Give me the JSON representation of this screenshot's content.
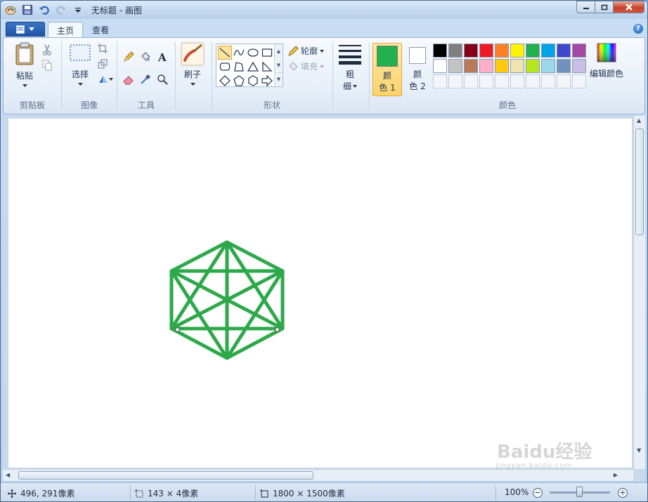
{
  "window": {
    "title": "无标题 - 画图"
  },
  "tabs": [
    {
      "label": "主页",
      "active": true
    },
    {
      "label": "查看",
      "active": false
    }
  ],
  "groups": {
    "clipboard": {
      "label": "剪贴板",
      "paste_label": "粘贴"
    },
    "image": {
      "label": "图像",
      "select_label": "选择"
    },
    "tools": {
      "label": "工具"
    },
    "brush": {
      "label": "刷子"
    },
    "shapes": {
      "label": "形状",
      "outline_label": "轮廓",
      "fill_label": "填充"
    },
    "size": {
      "label_line1": "粗",
      "label_line2": "细"
    },
    "colors": {
      "label": "颜色",
      "color1_line1": "颜",
      "color1_line2": "色 1",
      "color2_line1": "颜",
      "color2_line2": "色 2",
      "color1_value": "#22b14c",
      "color2_value": "#ffffff",
      "edit_label": "编辑颜色",
      "palette_row1": [
        "#000000",
        "#7f7f7f",
        "#880015",
        "#ed1c24",
        "#ff7f27",
        "#fff200",
        "#22b14c",
        "#00a2e8",
        "#3f48cc",
        "#a349a4"
      ],
      "palette_row2": [
        "#ffffff",
        "#c3c3c3",
        "#b97a57",
        "#ffaec9",
        "#ffc90e",
        "#efe4b0",
        "#b5e61d",
        "#99d9ea",
        "#7092be",
        "#c8bfe7"
      ]
    }
  },
  "drawing": {
    "stroke_color": "#2da84a"
  },
  "status": {
    "cursor_pos": "496, 291像素",
    "selection_size": "143 × 4像素",
    "image_size": "1800 × 1500像素",
    "zoom": "100%"
  },
  "watermark": {
    "text": "Baidu经验",
    "sub": "jingyan.baidu.com"
  }
}
